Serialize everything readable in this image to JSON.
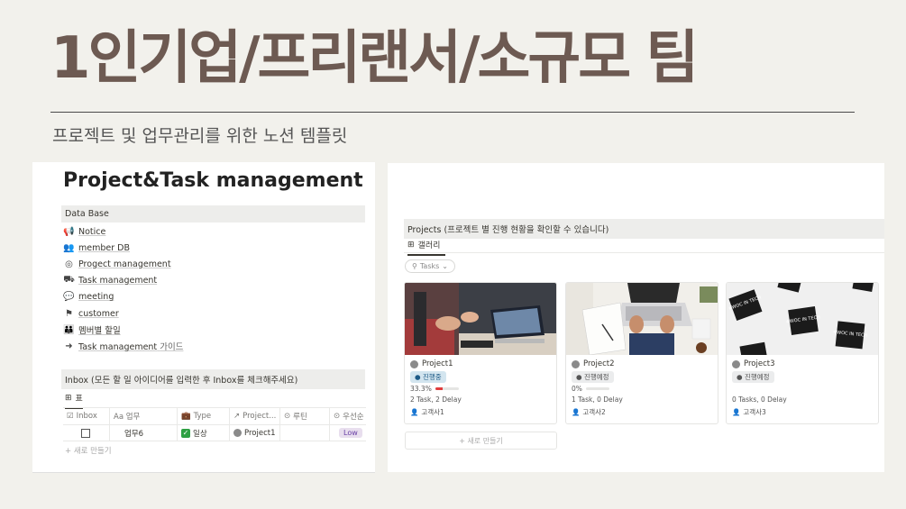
{
  "hero": {
    "title": "1인기업/프리랜서/소규모 팀",
    "subtitle": "프로젝트 및 업무관리를 위한 노션 템플릿"
  },
  "left_panel": {
    "page_title": "Project&Task management",
    "database_section": "Data Base",
    "databases": [
      {
        "icon": "megaphone-icon",
        "label": "Notice"
      },
      {
        "icon": "people-icon",
        "label": "member DB"
      },
      {
        "icon": "target-icon",
        "label": "Progect management"
      },
      {
        "icon": "task-icon",
        "label": "Task management"
      },
      {
        "icon": "chat-bubbles-icon",
        "label": "meeting"
      },
      {
        "icon": "signpost-icon",
        "label": "customer"
      },
      {
        "icon": "group-icon",
        "label": "멤버별 할일"
      },
      {
        "icon": "arrow-right-icon",
        "label": "Task management",
        "suffix": "가이드"
      }
    ],
    "inbox_section": "Inbox (모든 할 일 아이디어를 입력한 후 Inbox를 체크해주세요)",
    "view_tab": "표",
    "columns": [
      "Inbox",
      "Aa 업무",
      "Type",
      "Project...",
      "루틴",
      "우선순"
    ],
    "rows": [
      {
        "task": "업무6",
        "type": "일상",
        "project": "Project1",
        "priority": "Low"
      }
    ],
    "new_row": "+ 새로 만들기"
  },
  "right_panel": {
    "section": "Projects (프로젝트 별 진행 현황을 확인할 수 있습니다)",
    "view_tab": "갤러리",
    "search_chip": "Tasks",
    "cards": [
      {
        "name": "Project1",
        "status": "진행중",
        "status_color": "#d3e5ef",
        "progress_label": "33.3%",
        "progress": 0.333,
        "counts": "2 Task, 2 Delay",
        "client": "고객사1",
        "cover": "meeting-laptop-photo"
      },
      {
        "name": "Project2",
        "status": "진행예정",
        "status_color": "#ebeced",
        "progress_label": "0%",
        "progress": 0,
        "counts": "1 Task, 0 Delay",
        "client": "고객사2",
        "cover": "desk-laptop-photo"
      },
      {
        "name": "Project3",
        "status": "진행예정",
        "status_color": "#ebeced",
        "progress_label": "",
        "progress": null,
        "counts": "0 Tasks, 0 Delay",
        "client": "고객사3",
        "cover": "woc-in-tech-stickers-photo",
        "sticker_text": "#WOC IN TECH"
      }
    ],
    "new_card": "+ 새로 만들기"
  }
}
